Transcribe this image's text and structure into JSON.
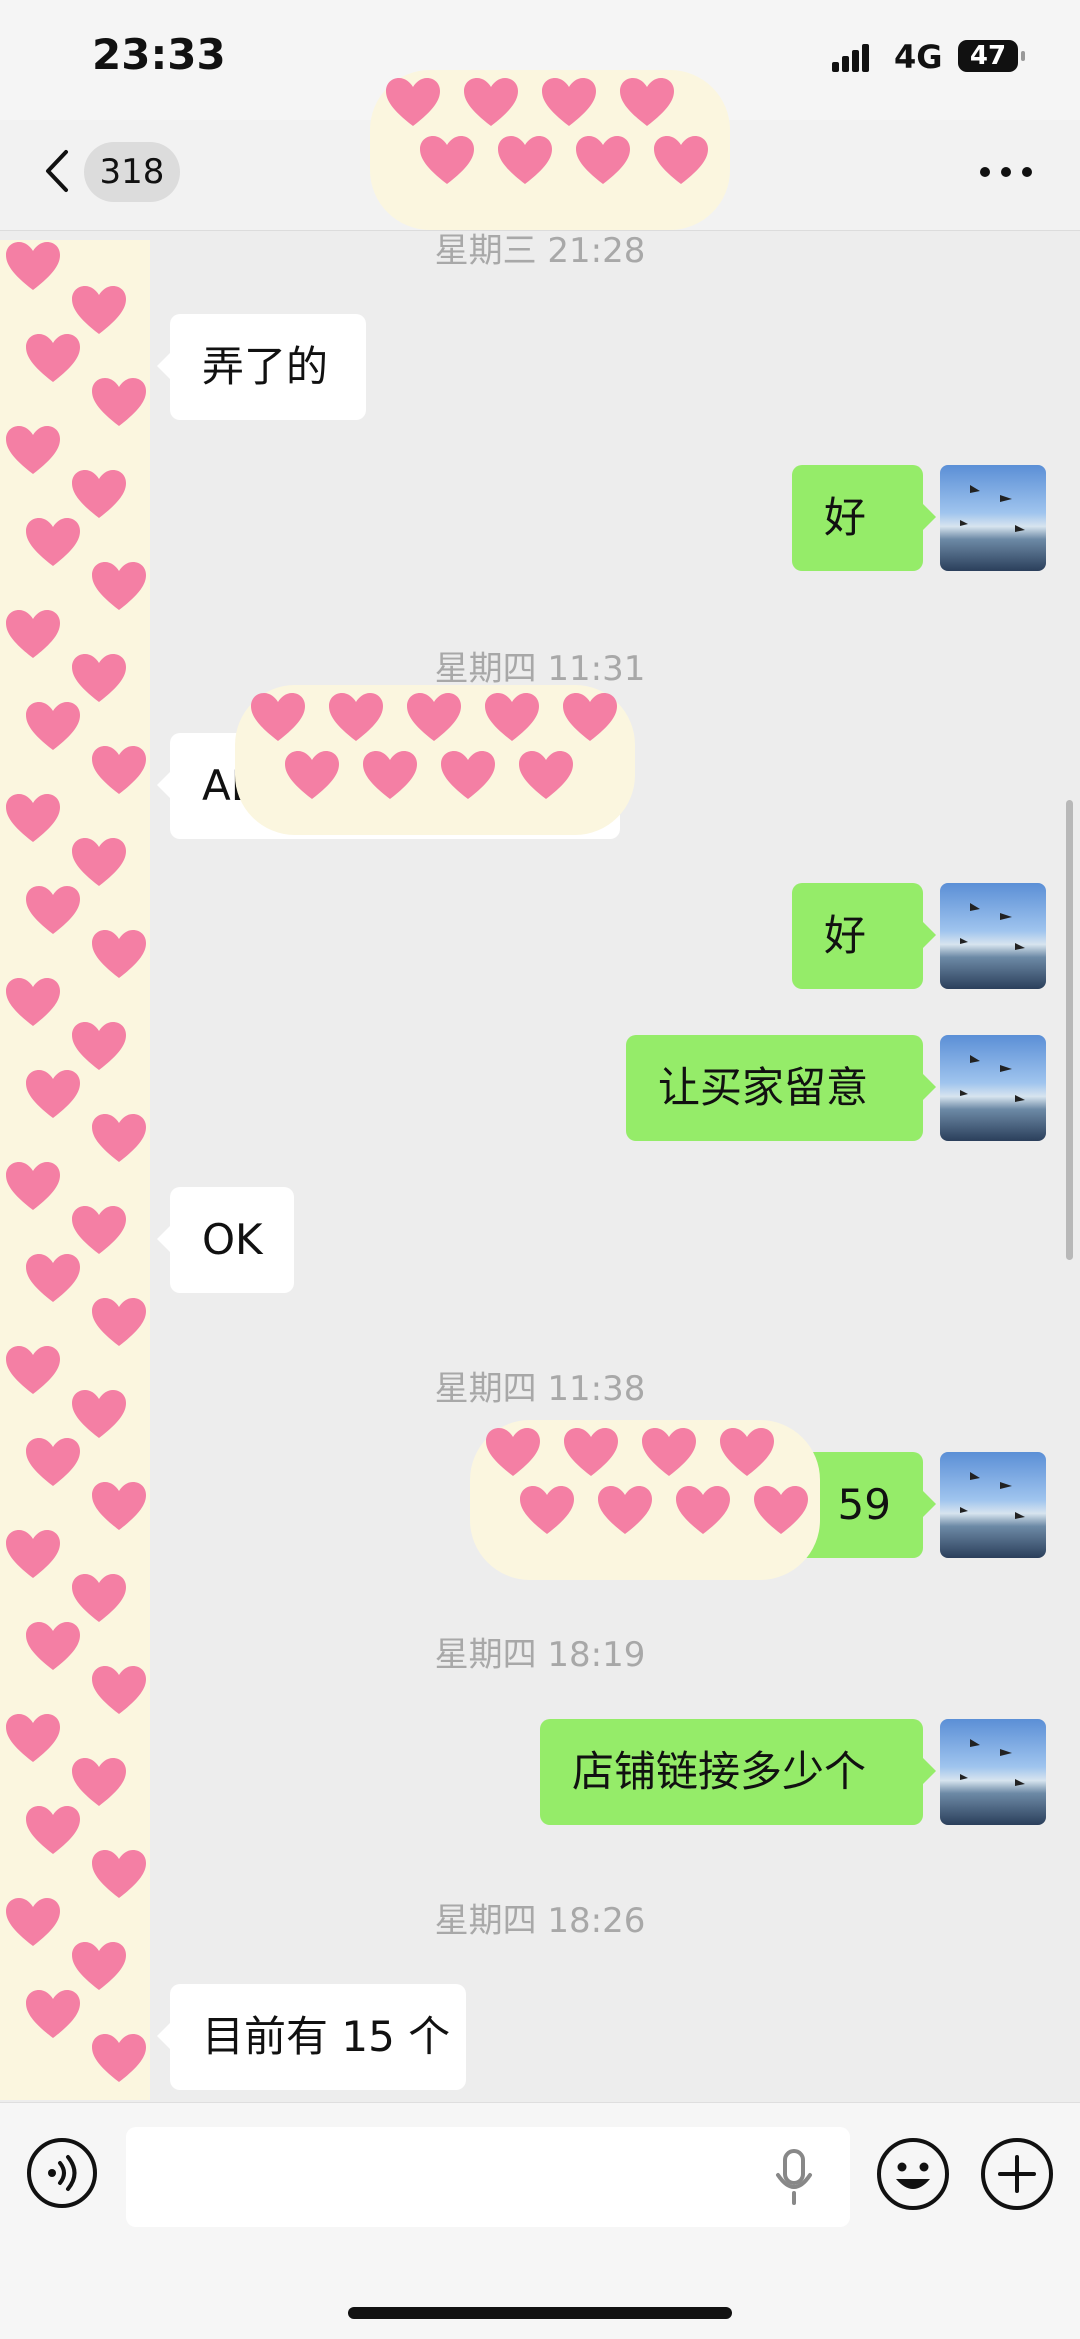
{
  "status_bar": {
    "time": "23:33",
    "network": "4G",
    "battery": "47"
  },
  "nav": {
    "unread_count": "318"
  },
  "messages": [
    {
      "type": "timestamp",
      "text": "星期三 21:28"
    },
    {
      "type": "message",
      "side": "left",
      "text": "弄了的"
    },
    {
      "type": "message",
      "side": "right",
      "text": "好"
    },
    {
      "type": "timestamp",
      "text": "星期四 11:31"
    },
    {
      "type": "message",
      "side": "left",
      "text": "ABC"
    },
    {
      "type": "message",
      "side": "right",
      "text": "好"
    },
    {
      "type": "message",
      "side": "right",
      "text": "让买家留意"
    },
    {
      "type": "message",
      "side": "left",
      "text": "OK"
    },
    {
      "type": "timestamp",
      "text": "星期四 11:38"
    },
    {
      "type": "message",
      "side": "right",
      "text": "59"
    },
    {
      "type": "timestamp",
      "text": "星期四 18:19"
    },
    {
      "type": "message",
      "side": "right",
      "text": "店铺链接多少个"
    },
    {
      "type": "timestamp",
      "text": "星期四 18:26"
    },
    {
      "type": "message",
      "side": "left",
      "text": "目前有 15 个"
    }
  ],
  "input": {
    "value": "",
    "placeholder": ""
  },
  "icons": {
    "back": "chevron-left-icon",
    "more": "more-icon",
    "voice": "voice-icon",
    "mic": "mic-icon",
    "emoji": "emoji-icon",
    "plus": "plus-icon"
  },
  "colors": {
    "self_bubble": "#95ec69",
    "other_bubble": "#ffffff",
    "background": "#ededed",
    "privacy_heart": "#f47fa4"
  }
}
